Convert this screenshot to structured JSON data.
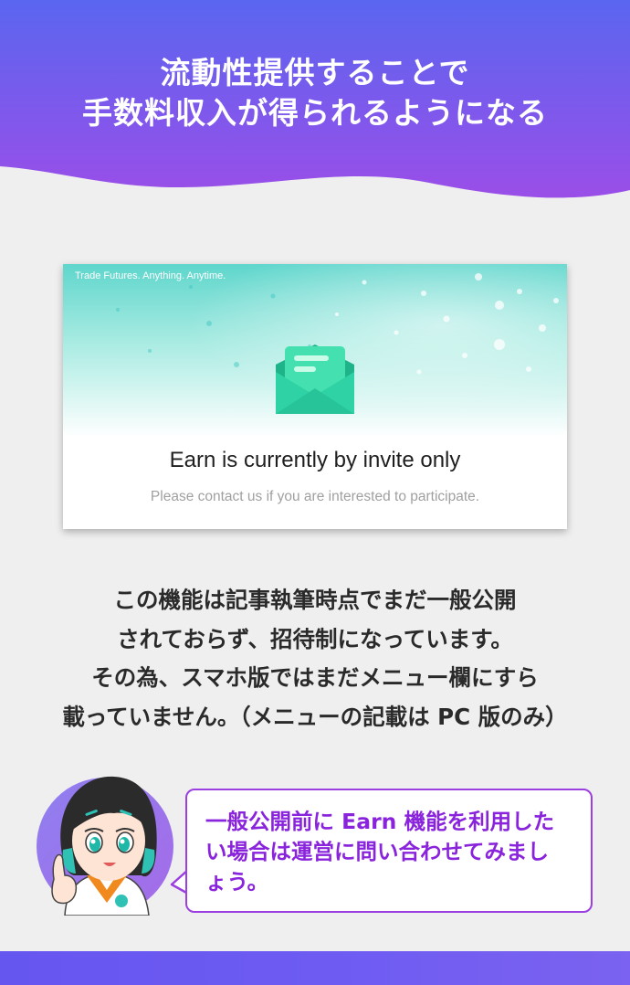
{
  "hero": {
    "title_line1": "流動性提供することで",
    "title_line2": "手数料収入が得られるようになる",
    "gradient_colors": [
      "#5a66f0",
      "#9a4ee8"
    ]
  },
  "card": {
    "tagline": "Trade Futures. Anything. Anytime.",
    "heading": "Earn is currently by invite only",
    "subtext": "Please contact us if you are interested to participate.",
    "icon": "envelope-icon",
    "accent_color": "#2fd2a4"
  },
  "body": {
    "line1": "この機能は記事執筆時点でまだ一般公開",
    "line2": "されておらず、招待制になっています。",
    "line3": "その為、スマホ版ではまだメニュー欄にすら",
    "line4": "載っていません。（メニューの記載は PC 版のみ）"
  },
  "speech": {
    "line1": "一般公開前に Earn 機能を利用した",
    "line2": "い場合は運営に問い合わせてみまし",
    "line3": "ょう。",
    "color": "#8a24dc"
  },
  "footer": {
    "color": "#6a59f1"
  }
}
